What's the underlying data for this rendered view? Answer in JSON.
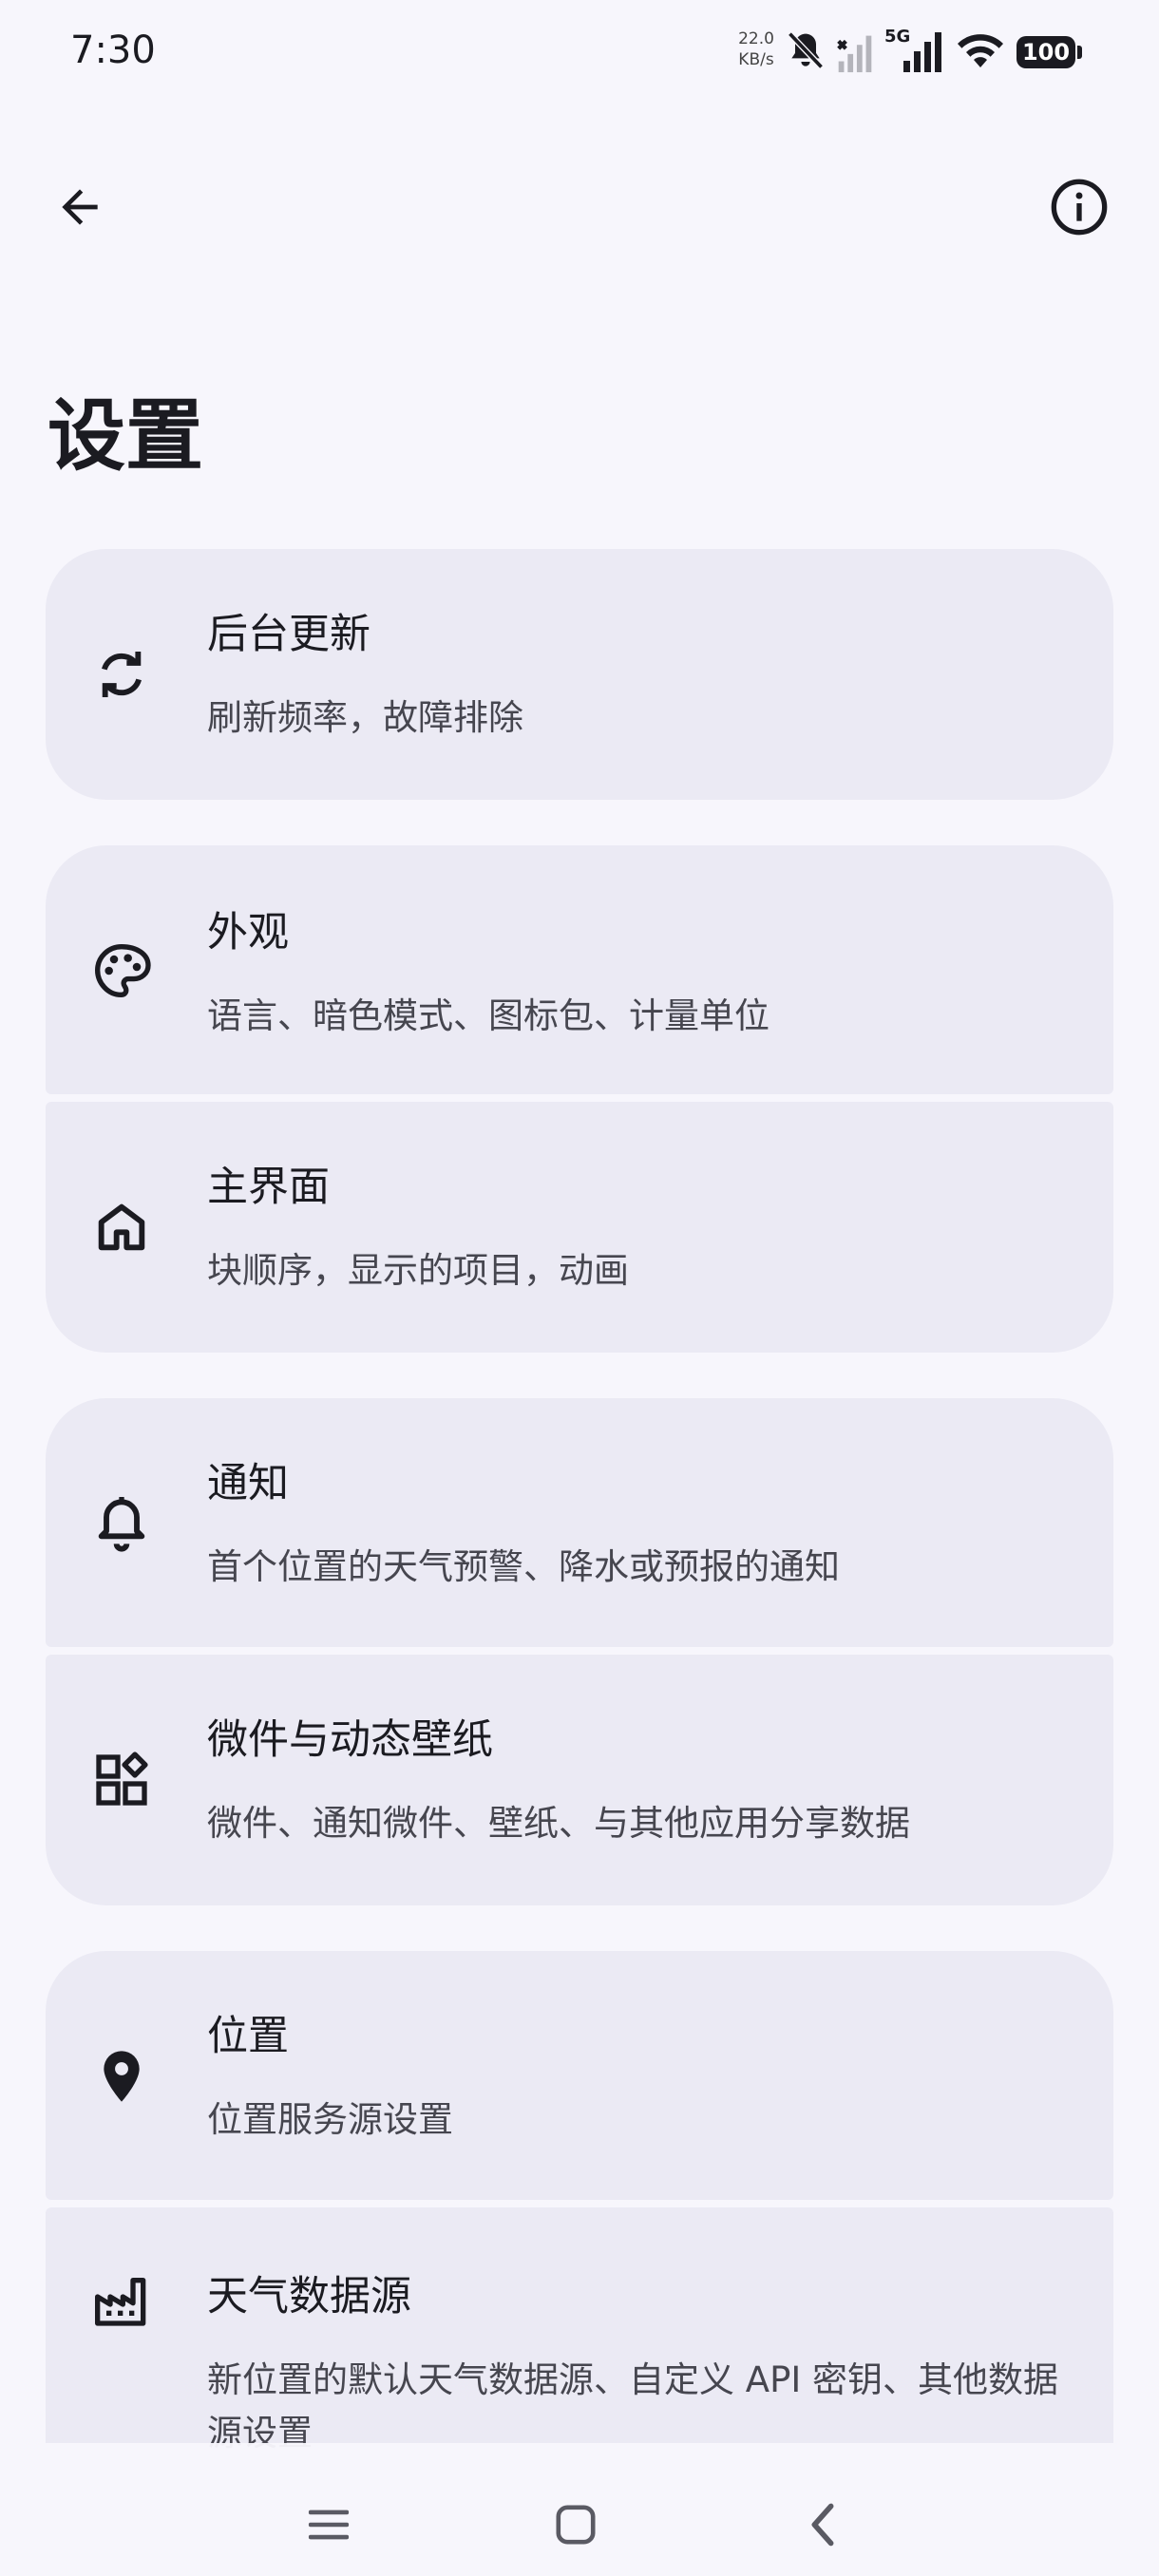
{
  "status_bar": {
    "time": "7:30",
    "net_speed_value": "22.0",
    "net_speed_unit": "KB/s",
    "network_type": "5G",
    "battery": "100",
    "icons": [
      "bell-off-icon",
      "signal-no-service-icon",
      "signal-5g-icon",
      "wifi-icon",
      "battery-icon"
    ]
  },
  "header": {
    "back_icon": "arrow-back-icon",
    "info_icon": "info-icon",
    "title": "设置"
  },
  "settings": [
    {
      "icon": "sync-icon",
      "title": "后台更新",
      "subtitle": "刷新频率，故障排除"
    },
    {
      "icon": "palette-icon",
      "title": "外观",
      "subtitle": "语言、暗色模式、图标包、计量单位"
    },
    {
      "icon": "home-icon",
      "title": "主界面",
      "subtitle": "块顺序，显示的项目，动画"
    },
    {
      "icon": "bell-icon",
      "title": "通知",
      "subtitle": "首个位置的天气预警、降水或预报的通知"
    },
    {
      "icon": "widgets-icon",
      "title": "微件与动态壁纸",
      "subtitle": "微件、通知微件、壁纸、与其他应用分享数据"
    },
    {
      "icon": "location-pin-icon",
      "title": "位置",
      "subtitle": "位置服务源设置"
    },
    {
      "icon": "factory-icon",
      "title": "天气数据源",
      "subtitle": "新位置的默认天气数据源、自定义 API 密钥、其他数据源设置"
    }
  ],
  "nav_bar": {
    "items": [
      "menu-icon",
      "home-square-icon",
      "back-chevron-icon"
    ]
  },
  "colors": {
    "background": "#f7f6fc",
    "card": "#ebeaf4",
    "text_primary": "#1b1b21",
    "text_secondary": "#46464f"
  }
}
